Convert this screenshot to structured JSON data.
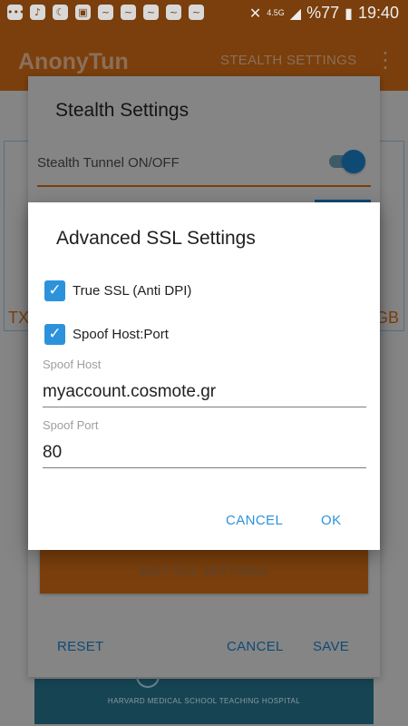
{
  "status_bar": {
    "battery": "%77",
    "time": "19:40",
    "network": "4.5G",
    "icons": [
      "message-icon",
      "music-icon",
      "moon-icon",
      "gallery-icon",
      "wave-icon",
      "wave-icon",
      "wave-icon",
      "wave-icon",
      "wave-icon"
    ]
  },
  "app": {
    "title": "AnonyTun",
    "action": "STEALTH SETTINGS",
    "edge_left": "TX",
    "edge_right": "GB",
    "banner_text": "HARVARD MEDICAL SCHOOL TEACHING HOSPITAL"
  },
  "stealth_dialog": {
    "title": "Stealth Settings",
    "tunnel_label": "Stealth Tunnel ON/OFF",
    "tunnel_on": true,
    "edit_ssl_label": "EDIT SSL SETTINGS",
    "reset_label": "RESET",
    "cancel_label": "CANCEL",
    "save_label": "SAVE"
  },
  "ssl_dialog": {
    "title": "Advanced SSL Settings",
    "true_ssl_label": "True SSL (Anti DPI)",
    "true_ssl_checked": true,
    "spoof_label": "Spoof Host:Port",
    "spoof_checked": true,
    "spoof_host_label": "Spoof Host",
    "spoof_host_value": "myaccount.cosmote.gr",
    "spoof_port_label": "Spoof Port",
    "spoof_port_value": "80",
    "cancel_label": "CANCEL",
    "ok_label": "OK"
  },
  "colors": {
    "accent": "#2d92dc",
    "brand_orange": "#f57c1f",
    "dim_overlay": "#858585"
  }
}
